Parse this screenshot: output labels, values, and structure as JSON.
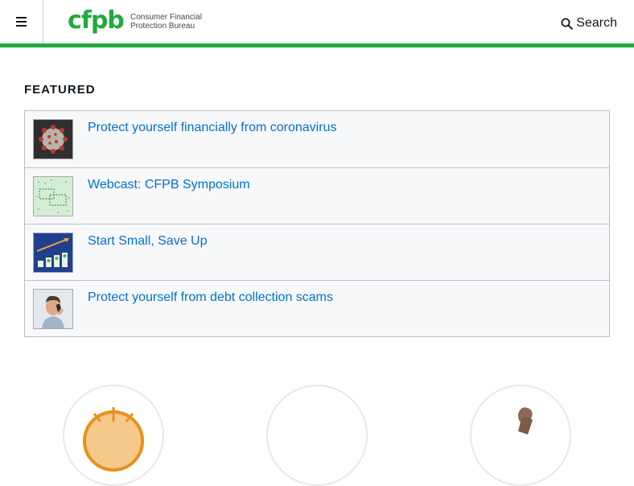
{
  "header": {
    "menu_icon": "hamburger-menu-icon",
    "logo": {
      "mark": "cfpb",
      "name": "Consumer Financial\nProtection Bureau"
    },
    "search": {
      "label": "Search",
      "icon": "search-icon"
    },
    "accent_color": "#20aa3f"
  },
  "featured": {
    "heading": "FEATURED",
    "items": [
      {
        "label": "Protect yourself financially from coronavirus",
        "thumb": "coronavirus-thumbnail"
      },
      {
        "label": "Webcast: CFPB Symposium",
        "thumb": "webcast-thumbnail"
      },
      {
        "label": "Start Small, Save Up",
        "thumb": "savings-chart-thumbnail"
      },
      {
        "label": "Protect yourself from debt collection scams",
        "thumb": "man-on-phone-thumbnail"
      }
    ]
  },
  "colors": {
    "link": "#0072ce",
    "border": "#bec0c3",
    "panel": "#f7f8f9"
  }
}
